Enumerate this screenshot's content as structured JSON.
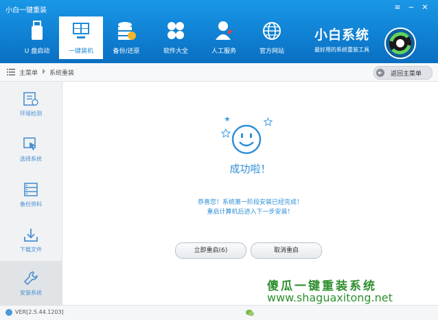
{
  "window": {
    "title": "小白一键重装"
  },
  "nav": [
    {
      "label": "U 盘启动",
      "icon": "usb-drive-icon"
    },
    {
      "label": "一键装机",
      "icon": "windows-logo-icon",
      "active": true
    },
    {
      "label": "备份/还原",
      "icon": "database-backup-icon"
    },
    {
      "label": "软件大全",
      "icon": "clover-apps-icon"
    },
    {
      "label": "人工服务",
      "icon": "user-heart-icon"
    },
    {
      "label": "官方网站",
      "icon": "globe-icon"
    }
  ],
  "brand": {
    "name": "小白系统",
    "slogan": "最好用的系统重装工具"
  },
  "breadcrumb": {
    "root": "主菜单",
    "current": "系统重装",
    "back_label": "返回主菜单"
  },
  "sidebar": [
    {
      "label": "环境检测",
      "icon": "checklist-icon"
    },
    {
      "label": "选择系统",
      "icon": "cursor-window-icon"
    },
    {
      "label": "备份资料",
      "icon": "stack-icon"
    },
    {
      "label": "下载文件",
      "icon": "download-icon"
    },
    {
      "label": "安装系统",
      "icon": "wrench-icon",
      "active": true
    }
  ],
  "main": {
    "success_text": "成功啦！",
    "message_line1": "恭喜您！系统第一阶段安装已经完成！",
    "message_line2": "重启计算机后进入下一步安装！",
    "restart_label": "立即重启(6)",
    "cancel_label": "取消重启"
  },
  "watermark": {
    "line1": "傻瓜一键重装系统",
    "line2": "www.shaguaxitong.net"
  },
  "status": {
    "version": "VER[2.5.44.1203]"
  },
  "colors": {
    "header": "#1287d6",
    "accent": "#2f8fd6",
    "watermark": "#2e8f2e"
  }
}
